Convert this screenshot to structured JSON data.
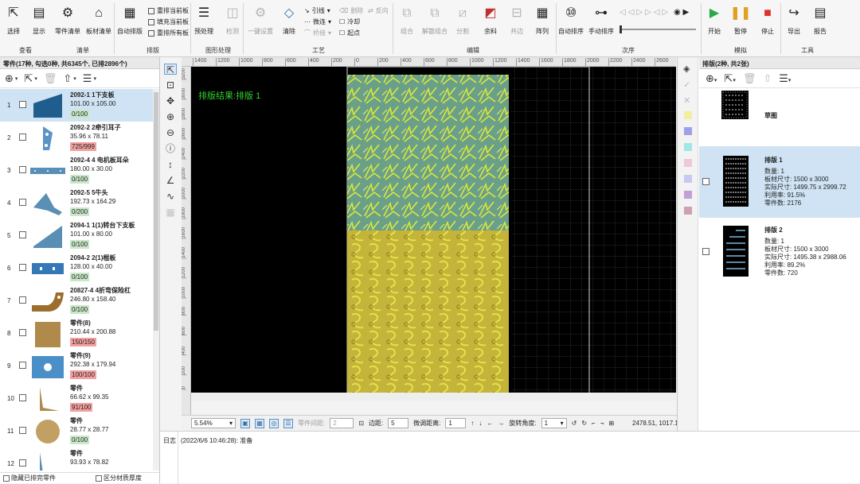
{
  "ribbon": {
    "buttons": [
      {
        "id": "select",
        "label": "选择",
        "icon": "cursor-icon",
        "dim": false
      },
      {
        "id": "display",
        "label": "显示",
        "icon": "display-icon",
        "dim": false
      },
      {
        "id": "parts_list",
        "label": "零件清单",
        "icon": "parts-list-icon",
        "dim": false
      },
      {
        "id": "sheet_list",
        "label": "板材清单",
        "icon": "sheet-list-icon",
        "dim": false
      },
      {
        "id": "auto_nest",
        "label": "自动排版",
        "icon": "auto-nest-icon",
        "dim": false
      },
      {
        "id": "preprocess",
        "label": "预处理",
        "icon": "preprocess-icon",
        "dim": false
      },
      {
        "id": "check",
        "label": "检测",
        "icon": "check-icon",
        "dim": true
      },
      {
        "id": "one_click",
        "label": "一键设置",
        "icon": "settings-gear-icon",
        "dim": true
      },
      {
        "id": "clear",
        "label": "清除",
        "icon": "eraser-icon",
        "dim": false
      },
      {
        "id": "combine",
        "label": "组合",
        "icon": "combine-icon",
        "dim": true
      },
      {
        "id": "uncombine",
        "label": "解散组合",
        "icon": "uncombine-icon",
        "dim": true
      },
      {
        "id": "split",
        "label": "分割",
        "icon": "split-icon",
        "dim": true
      },
      {
        "id": "remnant",
        "label": "余料",
        "icon": "remnant-icon",
        "dim": false
      },
      {
        "id": "common_edge",
        "label": "共边",
        "icon": "common-edge-icon",
        "dim": true
      },
      {
        "id": "array",
        "label": "阵列",
        "icon": "array-icon",
        "dim": false
      },
      {
        "id": "auto_sort",
        "label": "自动排序",
        "icon": "auto-sort-icon",
        "dim": false
      },
      {
        "id": "manual_sort",
        "label": "手动排序",
        "icon": "manual-sort-icon",
        "dim": false
      },
      {
        "id": "start",
        "label": "开始",
        "icon": "play-icon",
        "dim": false
      },
      {
        "id": "pause",
        "label": "暂停",
        "icon": "pause-icon",
        "dim": false
      },
      {
        "id": "stop",
        "label": "停止",
        "icon": "stop-icon",
        "dim": false
      },
      {
        "id": "export",
        "label": "导出",
        "icon": "export-icon",
        "dim": false
      },
      {
        "id": "report",
        "label": "报告",
        "icon": "report-icon",
        "dim": false
      }
    ],
    "small": {
      "rearrange_current": "重排当前板",
      "fill_current": "填充当前板",
      "rearrange_all": "重排所有板",
      "lead": "引线",
      "micro_joint": "微连",
      "bridge": "桥接",
      "delete": "删除",
      "cooling": "冷却",
      "start_point": "起点",
      "reverse": "反向",
      "closed": "封闭",
      "compensation": "补偿"
    },
    "groups": [
      "查看",
      "清单",
      "排版",
      "图形处理",
      "工艺",
      "编辑",
      "次序",
      "模拟",
      "工具"
    ]
  },
  "parts_panel": {
    "header": "零件(17种, 勾选0种, 共6345个, 已排2896个)",
    "items": [
      {
        "num": "1",
        "name": "2092-1 1下支板",
        "dims": "101.00 x 105.00",
        "count": "0/100",
        "status": "ok",
        "shape": "trapezoid-part-icon",
        "color": "#1f5d8c"
      },
      {
        "num": "2",
        "name": "2092-2 2牵引耳子",
        "dims": "35.96 x 78.11",
        "count": "725/999",
        "status": "bad",
        "shape": "ear-part-icon",
        "color": "#5b93c4"
      },
      {
        "num": "3",
        "name": "2092-4 4 电机板耳朵",
        "dims": "180.00 x 30.00",
        "count": "0/100",
        "status": "ok",
        "shape": "bar-part-icon",
        "color": "#5a8fb5"
      },
      {
        "num": "4",
        "name": "2092-5 5牛头",
        "dims": "192.73 x 164.29",
        "count": "0/200",
        "status": "ok",
        "shape": "bull-head-part-icon",
        "color": "#5a8fb5"
      },
      {
        "num": "5",
        "name": "2094-1 1(1)转台下支板",
        "dims": "101.00 x 80.00",
        "count": "0/100",
        "status": "ok",
        "shape": "wedge-part-icon",
        "color": "#5a8fb5"
      },
      {
        "num": "6",
        "name": "2094-2 2(1)棍板",
        "dims": "128.00 x 40.00",
        "count": "0/100",
        "status": "ok",
        "shape": "slotted-plate-part-icon",
        "color": "#3478b8"
      },
      {
        "num": "7",
        "name": "20827-4 4折弯保险杠",
        "dims": "246.80 x 158.40",
        "count": "0/100",
        "status": "ok",
        "shape": "bumper-part-icon",
        "color": "#9c6e2e"
      },
      {
        "num": "8",
        "name": "零件(8)",
        "dims": "210.44 x 200.88",
        "count": "150/150",
        "status": "bad",
        "shape": "square-part-icon",
        "color": "#b08a4b"
      },
      {
        "num": "9",
        "name": "零件(9)",
        "dims": "292.38 x 179.94",
        "count": "100/100",
        "status": "bad",
        "shape": "plate-hole-part-icon",
        "color": "#4a8fc8"
      },
      {
        "num": "10",
        "name": "零件",
        "dims": "66.62 x 99.35",
        "count": "91/100",
        "status": "bad",
        "shape": "triangle-part-icon",
        "color": "#b08a4b"
      },
      {
        "num": "11",
        "name": "零件",
        "dims": "28.77 x 28.77",
        "count": "0/100",
        "status": "ok",
        "shape": "circle-part-icon",
        "color": "#c2a063"
      },
      {
        "num": "12",
        "name": "零件",
        "dims": "93.93 x 78.82",
        "count": "",
        "status": "ok",
        "shape": "triangle-part-icon",
        "color": "#5a8fb5"
      }
    ],
    "footer": {
      "hide_nested": "隐藏已排完零件",
      "by_thickness": "区分材质厚度"
    }
  },
  "canvas": {
    "nest_label": "排版结果:排版 1",
    "ruler_top": [
      "1400",
      "1200",
      "1000",
      "800",
      "600",
      "400",
      "200",
      "0",
      "200",
      "400",
      "600",
      "800",
      "1000",
      "1200",
      "1400",
      "1600",
      "1800",
      "2000",
      "2200",
      "2400",
      "2600",
      "2800"
    ],
    "ruler_left": [
      "3200",
      "3000",
      "2800",
      "2600",
      "2400",
      "2200",
      "2000",
      "1800",
      "1600",
      "1400",
      "1200",
      "1000",
      "800",
      "600",
      "400",
      "200",
      "0"
    ]
  },
  "statusbar": {
    "zoom": "5.54%",
    "part_gap_label": "零件间距:",
    "part_gap": "2",
    "margin_label": "边距:",
    "margin": "5",
    "micro_dist_label": "微调距离:",
    "micro_dist": "1",
    "rotate_label": "旋转角度:",
    "rotate": "1",
    "coords": "2478.51, 1017.19"
  },
  "log": {
    "title": "日志",
    "message": "(2022/6/6 10:46:28): 准备"
  },
  "sheets_panel": {
    "header": "排版(2种, 共2张)",
    "draft": {
      "name": "草图"
    },
    "sheets": [
      {
        "name": "排版 1",
        "qty": "数量: 1",
        "sheet_size": "板材尺寸: 1500 x 3000",
        "actual": "实际尺寸: 1499.75 x 2999.72",
        "util": "利用率: 91.5%",
        "parts": "零件数: 2176"
      },
      {
        "name": "排版 2",
        "qty": "数量: 1",
        "sheet_size": "板材尺寸: 1500 x 3000",
        "actual": "实际尺寸: 1495.38 x 2988.06",
        "util": "利用率: 89.2%",
        "parts": "零件数: 720"
      }
    ],
    "layer_colors": [
      "#f0f0a0",
      "#a0a0e8",
      "#a0e8e8",
      "#f0c8d8",
      "#c8c8f0",
      "#c0a0d8",
      "#d0a0b0"
    ]
  }
}
